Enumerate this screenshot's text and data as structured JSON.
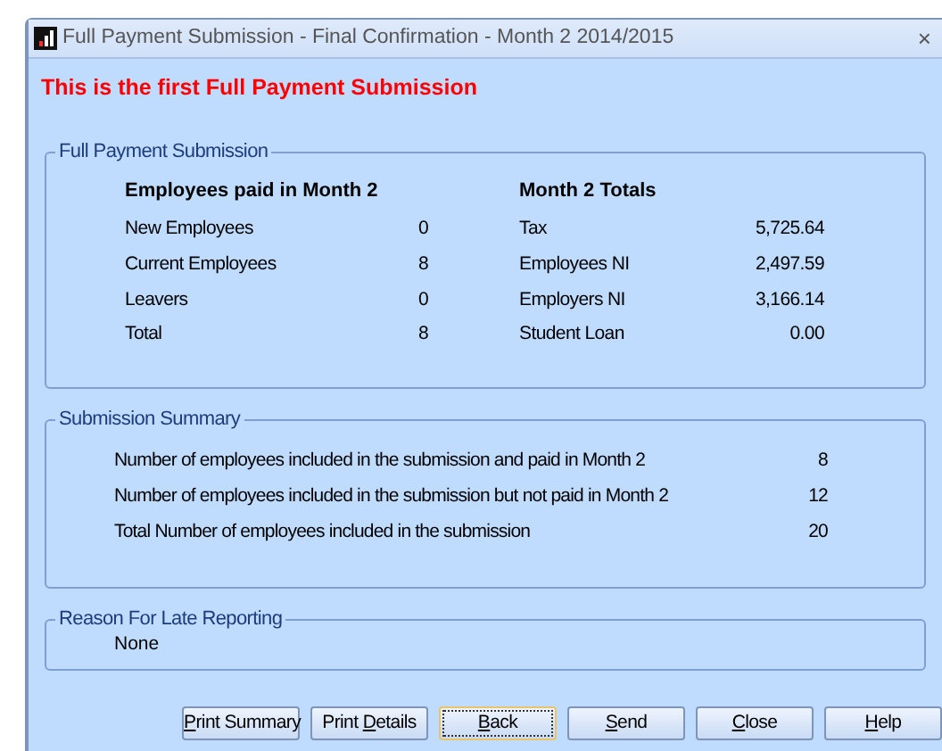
{
  "window": {
    "title": "Full Payment Submission - Final Confirmation - Month 2 2014/2015",
    "close": "×"
  },
  "notice": "This is the first Full Payment Submission",
  "full_payment_submission": {
    "title": "Full Payment Submission",
    "employees": {
      "heading": "Employees paid in Month 2",
      "rows": [
        {
          "label": "New Employees",
          "value": "0"
        },
        {
          "label": "Current Employees",
          "value": "8"
        },
        {
          "label": "Leavers",
          "value": "0"
        },
        {
          "label": "Total",
          "value": "8"
        }
      ]
    },
    "totals": {
      "heading": "Month 2 Totals",
      "rows": [
        {
          "label": "Tax",
          "value": "5,725.64"
        },
        {
          "label": "Employees NI",
          "value": "2,497.59"
        },
        {
          "label": "Employers NI",
          "value": "3,166.14"
        },
        {
          "label": "Student Loan",
          "value": "0.00"
        }
      ]
    }
  },
  "submission_summary": {
    "title": "Submission Summary",
    "rows": [
      {
        "label": "Number of employees included in the submission and paid in Month 2",
        "value": "8"
      },
      {
        "label": "Number of employees included in the submission but not paid in Month 2",
        "value": "12"
      },
      {
        "label": "Total Number of employees included in the submission",
        "value": "20"
      }
    ]
  },
  "late_reporting": {
    "title": "Reason For Late Reporting",
    "value": "None"
  },
  "buttons": [
    {
      "label_parts": [
        {
          "text": "P",
          "underlined": true
        },
        {
          "text": "rint Summary",
          "underlined": false
        }
      ],
      "focused": false
    },
    {
      "label_parts": [
        {
          "text": "Print ",
          "underlined": false
        },
        {
          "text": "D",
          "underlined": true
        },
        {
          "text": "etails",
          "underlined": false
        }
      ],
      "focused": false
    },
    {
      "label_parts": [
        {
          "text": "B",
          "underlined": true
        },
        {
          "text": "ack",
          "underlined": false
        }
      ],
      "focused": true
    },
    {
      "label_parts": [
        {
          "text": "S",
          "underlined": true
        },
        {
          "text": "end",
          "underlined": false
        }
      ],
      "focused": false
    },
    {
      "label_parts": [
        {
          "text": "C",
          "underlined": true
        },
        {
          "text": "lose",
          "underlined": false
        }
      ],
      "focused": false
    },
    {
      "label_parts": [
        {
          "text": "H",
          "underlined": true
        },
        {
          "text": "elp",
          "underlined": false
        }
      ],
      "focused": false
    }
  ]
}
